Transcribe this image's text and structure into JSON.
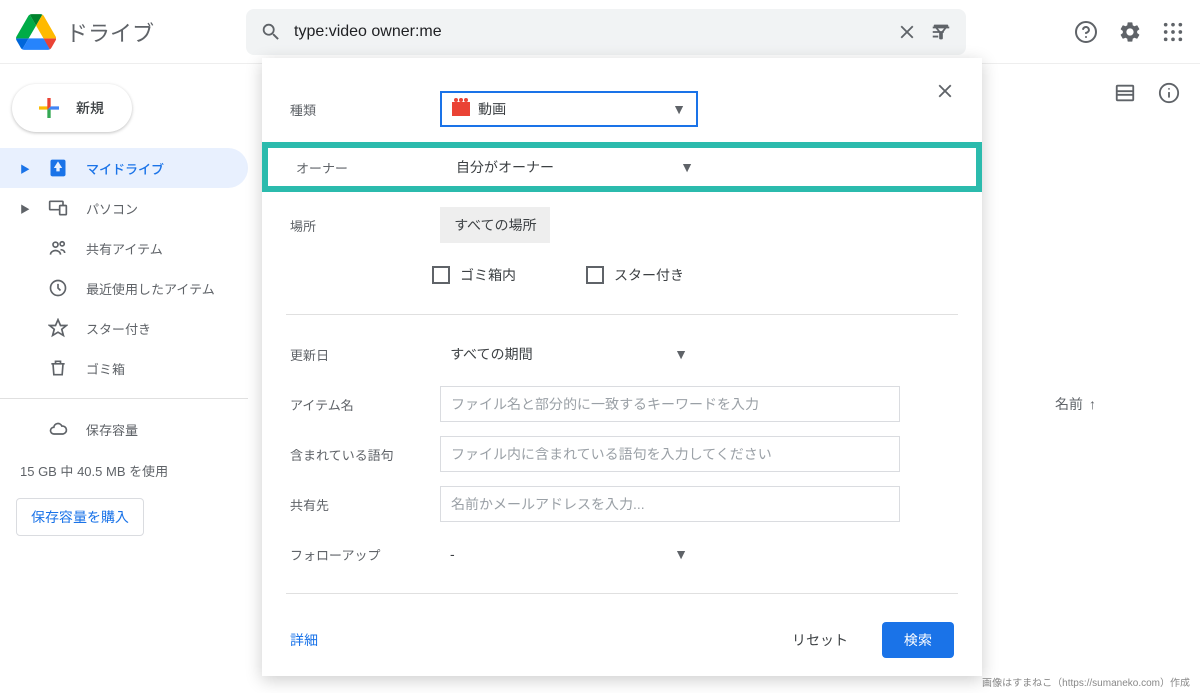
{
  "app": {
    "title": "ドライブ"
  },
  "search": {
    "value": "type:video owner:me"
  },
  "sidebar": {
    "new_label": "新規",
    "items": [
      {
        "label": "マイドライブ"
      },
      {
        "label": "パソコン"
      },
      {
        "label": "共有アイテム"
      },
      {
        "label": "最近使用したアイテム"
      },
      {
        "label": "スター付き"
      },
      {
        "label": "ゴミ箱"
      }
    ],
    "storage_label": "保存容量",
    "storage_text": "15 GB 中 40.5 MB を使用",
    "buy_label": "保存容量を購入"
  },
  "main": {
    "name_label": "名前"
  },
  "filter": {
    "type_label": "種類",
    "type_value": "動画",
    "owner_label": "オーナー",
    "owner_value": "自分がオーナー",
    "location_label": "場所",
    "location_value": "すべての場所",
    "trash_label": "ゴミ箱内",
    "starred_label": "スター付き",
    "date_label": "更新日",
    "date_value": "すべての期間",
    "name_label": "アイテム名",
    "name_placeholder": "ファイル名と部分的に一致するキーワードを入力",
    "words_label": "含まれている語句",
    "words_placeholder": "ファイル内に含まれている語句を入力してください",
    "share_label": "共有先",
    "share_placeholder": "名前かメールアドレスを入力...",
    "followup_label": "フォローアップ",
    "followup_value": "-",
    "details_label": "詳細",
    "reset_label": "リセット",
    "search_label": "検索"
  },
  "attribution": "画像はすまねこ（https://sumaneko.com）作成"
}
